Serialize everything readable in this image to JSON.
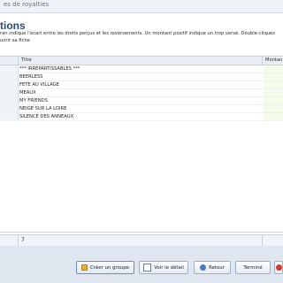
{
  "window": {
    "title": "es de royalties"
  },
  "heading": {
    "title": "tions",
    "description_line1": "ran indique l'écart entre les droits perçus et les reversements. Un montant positif indique un trop versé. Double-cliquez",
    "description_line2": "uvrir sa fiche"
  },
  "grid": {
    "columns": [
      "Titre",
      "Montan"
    ],
    "rows": [
      {
        "title": "*** IRREPARTISSABLES ***"
      },
      {
        "title": "BEERLESS"
      },
      {
        "title": "FETE AU VILLAGE"
      },
      {
        "title": "MEAUX"
      },
      {
        "title": "MY FRIENDS"
      },
      {
        "title": "NEIGE SUR LA LOIRE"
      },
      {
        "title": "SILENCE DES ANNEAUX"
      }
    ],
    "footer_count": "7"
  },
  "toolbar": {
    "create_group_label": "Créer un groupe",
    "view_detail_label": "Voir le détail",
    "back_label": "Retour",
    "done_label": "Terminé"
  },
  "icons": {
    "create_group": "group-icon",
    "view_detail": "detail-icon",
    "back": "back-arrow-icon",
    "extra": "close-icon"
  }
}
